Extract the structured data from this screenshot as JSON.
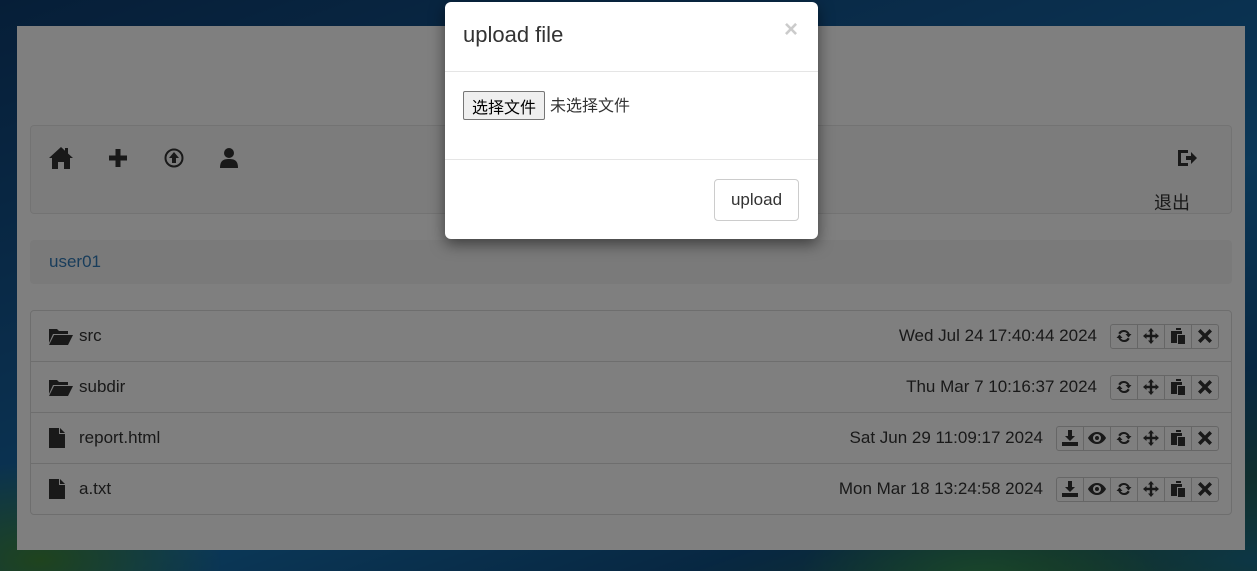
{
  "navbar": {
    "icons": [
      "home-icon",
      "plus-icon",
      "upload-icon",
      "user-icon"
    ],
    "logout_icon": "logout-icon",
    "logout_label": "退出"
  },
  "breadcrumb": {
    "current": "user01"
  },
  "files": [
    {
      "name": "src",
      "type": "folder",
      "date": "Wed Jul 24 17:40:44 2024",
      "actions": [
        "rename",
        "move",
        "copy",
        "delete"
      ]
    },
    {
      "name": "subdir",
      "type": "folder",
      "date": "Thu Mar 7 10:16:37 2024",
      "actions": [
        "rename",
        "move",
        "copy",
        "delete"
      ]
    },
    {
      "name": "report.html",
      "type": "file",
      "date": "Sat Jun 29 11:09:17 2024",
      "actions": [
        "download",
        "view",
        "rename",
        "move",
        "copy",
        "delete"
      ]
    },
    {
      "name": "a.txt",
      "type": "file",
      "date": "Mon Mar 18 13:24:58 2024",
      "actions": [
        "download",
        "view",
        "rename",
        "move",
        "copy",
        "delete"
      ]
    }
  ],
  "modal": {
    "title": "upload file",
    "close_symbol": "×",
    "choose_file_label": "选择文件",
    "file_status": "未选择文件",
    "upload_label": "upload"
  }
}
